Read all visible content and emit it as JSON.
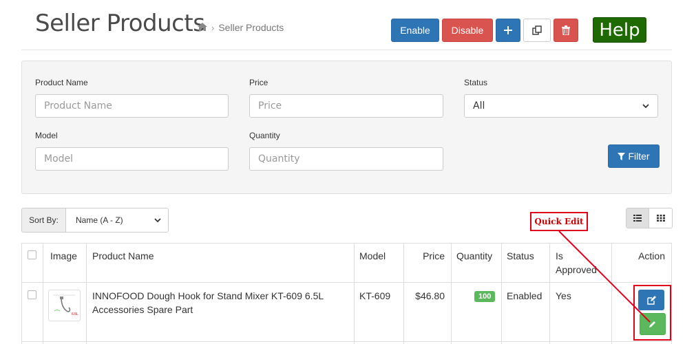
{
  "header": {
    "title": "Seller Products",
    "breadcrumb": [
      {
        "icon": "home-icon"
      },
      {
        "label": "Seller Products"
      }
    ],
    "buttons": {
      "enable": "Enable",
      "disable": "Disable",
      "help": "Help"
    }
  },
  "filters": {
    "product_name": {
      "label": "Product Name",
      "placeholder": "Product Name"
    },
    "price": {
      "label": "Price",
      "placeholder": "Price"
    },
    "status": {
      "label": "Status",
      "selected": "All"
    },
    "model": {
      "label": "Model",
      "placeholder": "Model"
    },
    "quantity": {
      "label": "Quantity",
      "placeholder": "Quantity"
    },
    "filter_button": "Filter"
  },
  "sort": {
    "label": "Sort By:",
    "selected": "Name (A - Z)"
  },
  "annotation": {
    "quick_edit": "Quick Edit"
  },
  "table": {
    "columns": {
      "image": "Image",
      "name": "Product Name",
      "model": "Model",
      "price": "Price",
      "quantity": "Quantity",
      "status": "Status",
      "approved_1": "Is",
      "approved_2": "Approved",
      "action": "Action"
    },
    "rows": [
      {
        "name_line1": "INNOFOOD Dough Hook for Stand Mixer KT-609 6.5L",
        "name_line2": "Accessories Spare Part",
        "model": "KT-609",
        "price": "$46.80",
        "quantity": "100",
        "status": "Enabled",
        "approved": "Yes"
      }
    ]
  },
  "colors": {
    "primary": "#2e75b6",
    "danger": "#d9534f",
    "help": "#1f6a00",
    "success": "#5cb85c",
    "annotation": "#e0001a"
  }
}
